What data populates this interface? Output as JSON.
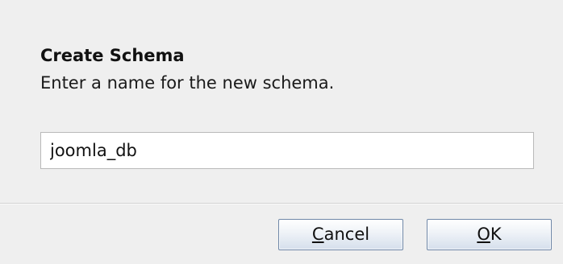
{
  "dialog": {
    "title": "Create Schema",
    "message": "Enter a name for the new schema.",
    "schema_name_value": "joomla_db"
  },
  "buttons": {
    "cancel": {
      "mnemonic": "C",
      "rest": "ancel"
    },
    "ok": {
      "mnemonic": "O",
      "rest": "K"
    }
  },
  "colors": {
    "background": "#efefef",
    "input_border": "#b9b9b9",
    "button_border": "#6f87a7"
  }
}
